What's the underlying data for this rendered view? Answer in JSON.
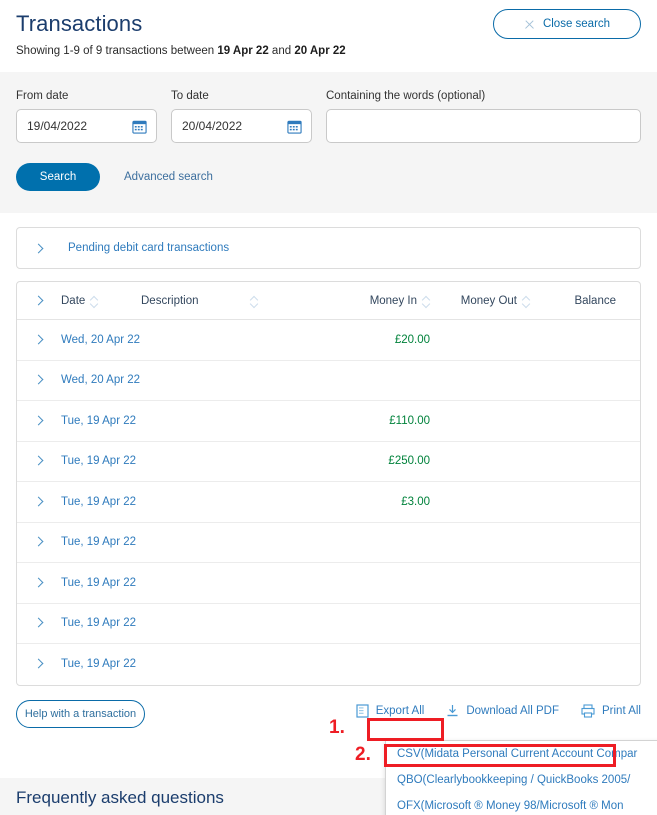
{
  "header": {
    "title": "Transactions",
    "subtitle_pre": "Showing 1-9 of 9 transactions between ",
    "subtitle_from": "19 Apr 22",
    "subtitle_mid": " and ",
    "subtitle_to": "20 Apr 22",
    "close_search_label": "Close search"
  },
  "search": {
    "from_label": "From date",
    "from_value": "19/04/2022",
    "to_label": "To date",
    "to_value": "20/04/2022",
    "words_label": "Containing the words (optional)",
    "words_value": "",
    "words_placeholder": "",
    "search_button": "Search",
    "advanced_search": "Advanced search"
  },
  "pending": {
    "label": "Pending debit card transactions"
  },
  "table": {
    "columns": [
      "Date",
      "Description",
      "Money In",
      "Money Out",
      "Balance"
    ],
    "rows": [
      {
        "date": "Wed, 20 Apr 22",
        "description": "",
        "money_in": "£20.00",
        "money_out": "",
        "balance": ""
      },
      {
        "date": "Wed, 20 Apr 22",
        "description": "",
        "money_in": "",
        "money_out": "",
        "balance": ""
      },
      {
        "date": "Tue, 19 Apr 22",
        "description": "",
        "money_in": "£110.00",
        "money_out": "",
        "balance": ""
      },
      {
        "date": "Tue, 19 Apr 22",
        "description": "",
        "money_in": "£250.00",
        "money_out": "",
        "balance": ""
      },
      {
        "date": "Tue, 19 Apr 22",
        "description": "",
        "money_in": "£3.00",
        "money_out": "",
        "balance": ""
      },
      {
        "date": "Tue, 19 Apr 22",
        "description": "",
        "money_in": "",
        "money_out": "",
        "balance": ""
      },
      {
        "date": "Tue, 19 Apr 22",
        "description": "",
        "money_in": "",
        "money_out": "",
        "balance": ""
      },
      {
        "date": "Tue, 19 Apr 22",
        "description": "",
        "money_in": "",
        "money_out": "",
        "balance": ""
      },
      {
        "date": "Tue, 19 Apr 22",
        "description": "",
        "money_in": "",
        "money_out": "",
        "balance": ""
      }
    ]
  },
  "footer": {
    "help_label": "Help with a transaction",
    "export_all_label": "Export All",
    "download_pdf_label": "Download All PDF",
    "print_all_label": "Print All"
  },
  "dropdown": {
    "options": [
      "CSV(Midata Personal Current Account Compar",
      "QBO(Clearlybookkeeping / QuickBooks 2005/",
      "OFX(Microsoft ® Money 98/Microsoft ® Mon"
    ]
  },
  "faq": {
    "title": "Frequently asked questions"
  },
  "annotations": {
    "step1": "1.",
    "step2": "2."
  },
  "colors": {
    "brand_blue": "#0070ad",
    "link_blue": "#2f7bbd",
    "title_navy": "#1b3d6d",
    "money_in_green": "#00823b",
    "annotation_red": "#ee1d24",
    "panel_grey": "#f5f5f5"
  }
}
